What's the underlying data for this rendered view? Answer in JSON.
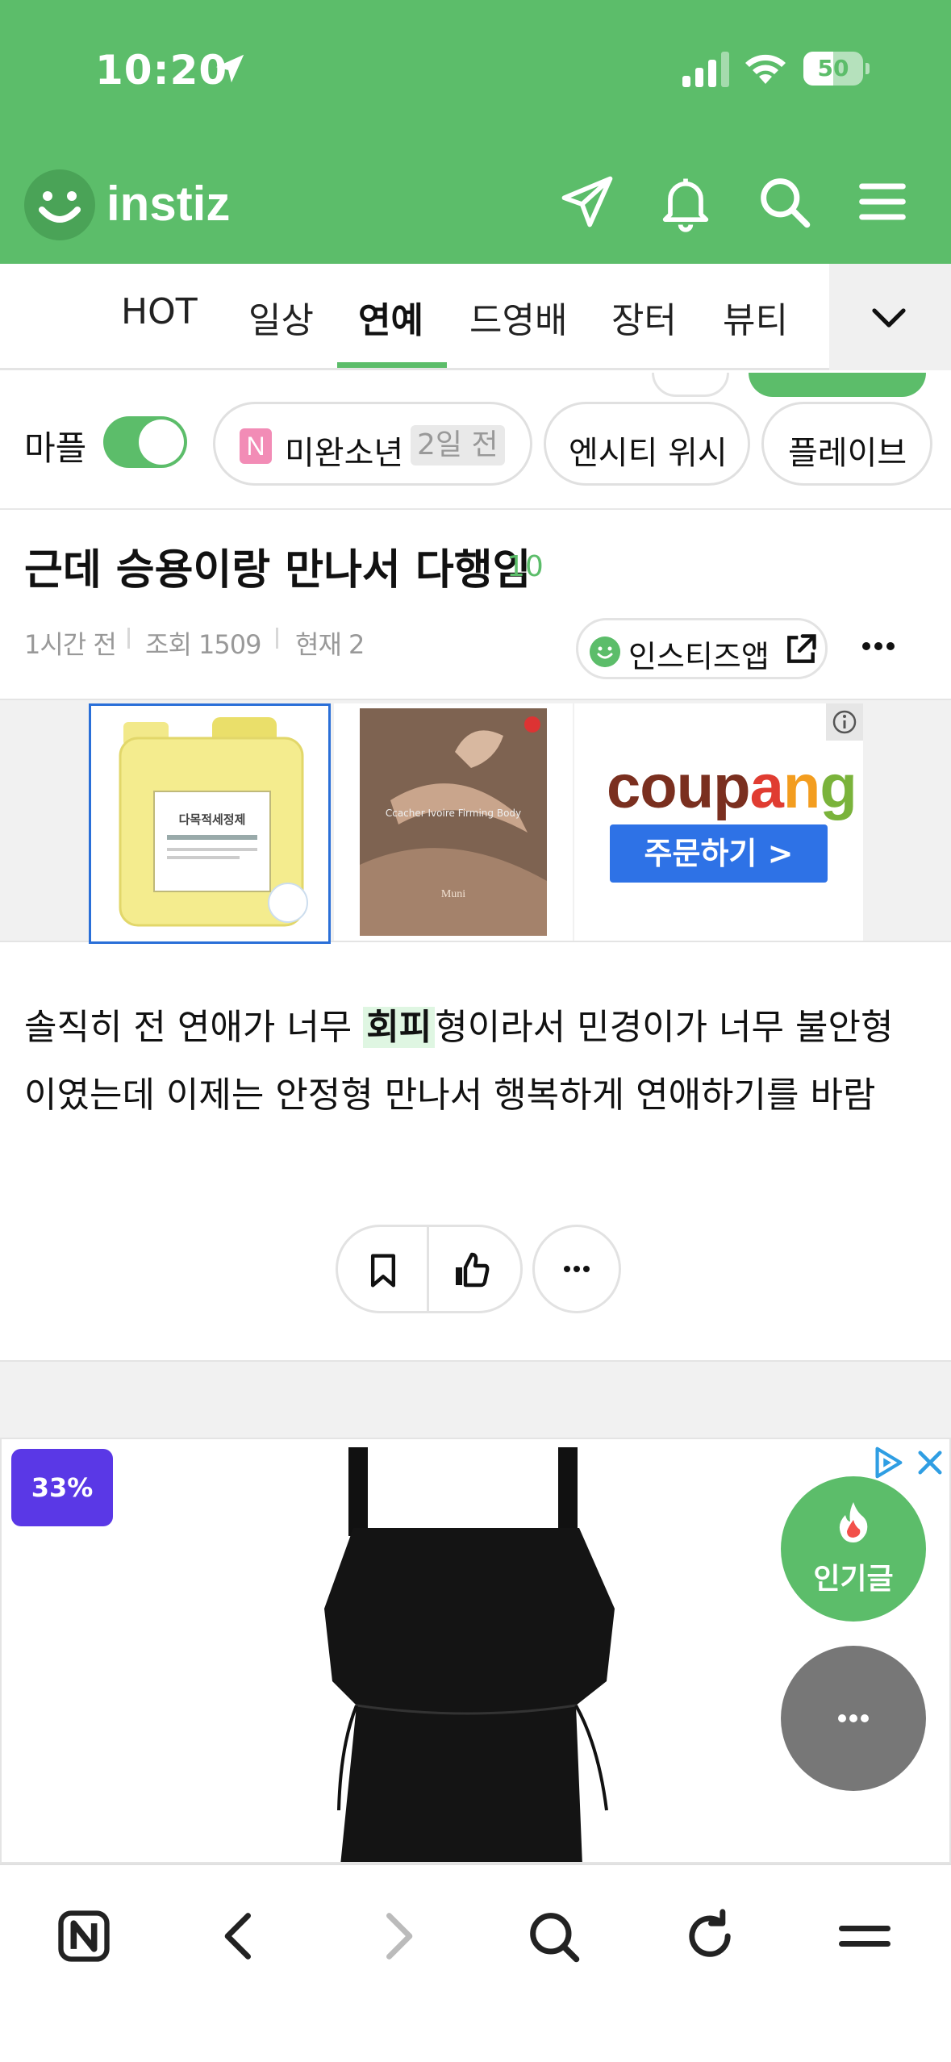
{
  "status_bar": {
    "time": "10:20",
    "battery": "50",
    "battery_level": 0.5
  },
  "header": {
    "logo_text": "instiz",
    "icons": [
      "send-icon",
      "bell-icon",
      "search-icon",
      "menu-icon"
    ]
  },
  "tabs": [
    {
      "label": "HOT",
      "active": false
    },
    {
      "label": "일상",
      "active": false
    },
    {
      "label": "연예",
      "active": true
    },
    {
      "label": "드영배",
      "active": false
    },
    {
      "label": "장터",
      "active": false
    },
    {
      "label": "뷰티",
      "active": false
    }
  ],
  "chips": {
    "mapl_label": "마플",
    "mapl_on": true,
    "items": [
      {
        "badge": "N",
        "label": "미완소년",
        "age": "2일 전"
      },
      {
        "label": "엔시티 위시"
      },
      {
        "label": "플레이브"
      }
    ]
  },
  "post": {
    "title": "근데 승용이랑 만나서 다행임",
    "comment_count": "10",
    "time_ago": "1시간 전",
    "views": "조회 1509",
    "current": "현재 2",
    "app_button": "인스티즈앱",
    "body_line1_pre": "솔직히 전 연애가 너무 ",
    "body_highlight": "회피",
    "body_line1_post": "형이라서 민경이가 너무 불안형",
    "body_line2": "이였는데 이제는 안정형 만나서 행복하게 연애하기를 바람"
  },
  "ad_banner": {
    "brand": "coupang",
    "order_button": "주문하기 >",
    "product1_label": "다목적세정제",
    "product2_label": "Ccacher Ivoire Firming Body",
    "product2_sub": "Muni"
  },
  "dress_ad": {
    "discount_badge": "33%"
  },
  "fabs": {
    "popular_label": "인기글"
  },
  "colors": {
    "brand_green": "#5cbd6a",
    "coupang_blue": "#2e72e6",
    "badge_purple": "#5a38e6"
  }
}
